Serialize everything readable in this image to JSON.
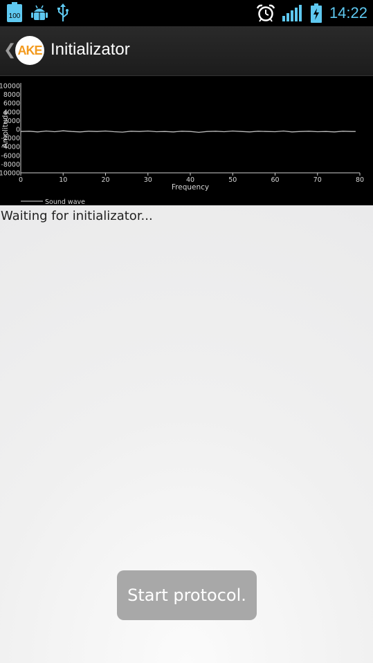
{
  "status_bar": {
    "battery_badge": "100",
    "time": "14:22",
    "icons": [
      "battery-notification-icon",
      "android-debug-icon",
      "usb-icon",
      "alarm-clock-icon",
      "signal-strength-icon",
      "battery-charging-icon"
    ],
    "accent_color": "#5ec8f0"
  },
  "action_bar": {
    "logo_text": "AKE",
    "title": "Initializator",
    "logo_color": "#f39a1e"
  },
  "chart_data": {
    "type": "line",
    "xlabel": "Frequency",
    "ylabel": "Amplitude",
    "xlim": [
      0,
      80
    ],
    "ylim": [
      -10000,
      10000
    ],
    "x_ticks": [
      0,
      10,
      20,
      30,
      40,
      50,
      60,
      70,
      80
    ],
    "y_ticks": [
      10000,
      8000,
      6000,
      4000,
      2000,
      0,
      -2000,
      -4000,
      -6000,
      -8000,
      -10000
    ],
    "grid": false,
    "legend": "bottom-left",
    "series": [
      {
        "name": "Sound wave",
        "x": [
          0,
          2,
          4,
          6,
          8,
          10,
          12,
          14,
          16,
          18,
          20,
          22,
          24,
          26,
          28,
          30,
          32,
          34,
          36,
          38,
          40,
          42,
          44,
          46,
          48,
          50,
          52,
          54,
          56,
          58,
          60,
          62,
          64,
          66,
          68,
          70,
          72,
          74,
          76,
          78,
          79
        ],
        "y": [
          -500,
          -450,
          -600,
          -400,
          -550,
          -350,
          -500,
          -600,
          -450,
          -500,
          -400,
          -550,
          -650,
          -450,
          -500,
          -400,
          -550,
          -500,
          -600,
          -450,
          -500,
          -700,
          -500,
          -450,
          -550,
          -400,
          -500,
          -600,
          -450,
          -500,
          -550,
          -400,
          -600,
          -500,
          -450,
          -550,
          -500,
          -600,
          -450,
          -500,
          -500
        ]
      }
    ]
  },
  "main": {
    "status_text": "Waiting for initializator...",
    "start_button_label": "Start protocol."
  }
}
